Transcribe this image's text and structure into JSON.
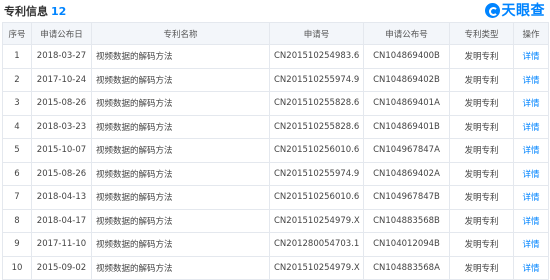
{
  "section": {
    "title": "专利信息",
    "count": "12"
  },
  "brand": {
    "name": "天眼查",
    "icon": "tianyancha-logo-icon",
    "color": "#0084ff"
  },
  "table": {
    "columns": [
      "序号",
      "申请公布日",
      "专利名称",
      "申请号",
      "申请公布号",
      "专利类型",
      "操作"
    ],
    "rows": [
      {
        "no": "1",
        "date": "2018-03-27",
        "name": "视频数据的解码方法",
        "app_no": "CN201510254983.6",
        "pub_no": "CN104869400B",
        "type": "发明专利",
        "action": "详情"
      },
      {
        "no": "2",
        "date": "2017-10-24",
        "name": "视频数据的解码方法",
        "app_no": "CN201510255974.9",
        "pub_no": "CN104869402B",
        "type": "发明专利",
        "action": "详情"
      },
      {
        "no": "3",
        "date": "2015-08-26",
        "name": "视频数据的解码方法",
        "app_no": "CN201510255828.6",
        "pub_no": "CN104869401A",
        "type": "发明专利",
        "action": "详情"
      },
      {
        "no": "4",
        "date": "2018-03-23",
        "name": "视频数据的解码方法",
        "app_no": "CN201510255828.6",
        "pub_no": "CN104869401B",
        "type": "发明专利",
        "action": "详情"
      },
      {
        "no": "5",
        "date": "2015-10-07",
        "name": "视频数据的解码方法",
        "app_no": "CN201510256010.6",
        "pub_no": "CN104967847A",
        "type": "发明专利",
        "action": "详情"
      },
      {
        "no": "6",
        "date": "2015-08-26",
        "name": "视频数据的解码方法",
        "app_no": "CN201510255974.9",
        "pub_no": "CN104869402A",
        "type": "发明专利",
        "action": "详情"
      },
      {
        "no": "7",
        "date": "2018-04-13",
        "name": "视频数据的解码方法",
        "app_no": "CN201510256010.6",
        "pub_no": "CN104967847B",
        "type": "发明专利",
        "action": "详情"
      },
      {
        "no": "8",
        "date": "2018-04-17",
        "name": "视频数据的解码方法",
        "app_no": "CN201510254979.X",
        "pub_no": "CN104883568B",
        "type": "发明专利",
        "action": "详情"
      },
      {
        "no": "9",
        "date": "2017-11-10",
        "name": "视频数据的解码方法",
        "app_no": "CN201280054703.1",
        "pub_no": "CN104012094B",
        "type": "发明专利",
        "action": "详情"
      },
      {
        "no": "10",
        "date": "2015-09-02",
        "name": "视频数据的解码方法",
        "app_no": "CN201510254979.X",
        "pub_no": "CN104883568A",
        "type": "发明专利",
        "action": "详情"
      }
    ]
  }
}
